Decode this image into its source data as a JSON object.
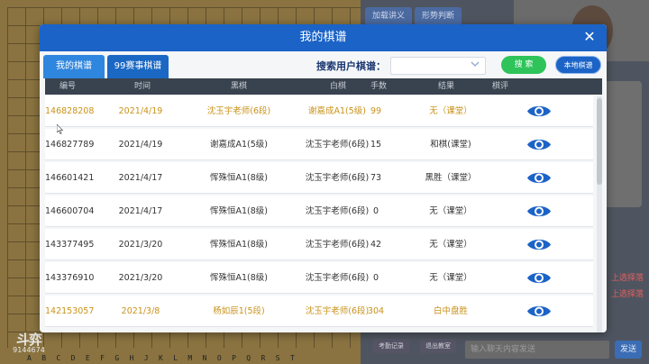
{
  "modal": {
    "title": "我的棋谱",
    "close_icon": "close-icon",
    "tabs": [
      {
        "label": "我的棋谱",
        "active": true
      },
      {
        "label": "99赛事棋谱",
        "active": false
      }
    ],
    "search_label": "搜索用户棋谱：",
    "search_value": "",
    "search_button": "搜 索",
    "local_button": "本地棋谱"
  },
  "table": {
    "headers": [
      "编号",
      "时间",
      "黑棋",
      "白棋",
      "手数",
      "结果",
      "棋评"
    ],
    "rows": [
      {
        "id": "146828208",
        "date": "2021/4/19",
        "black": "沈玉宇老师(6段)",
        "white": "谢嘉成A1(5级)",
        "moves": "99",
        "result": "无（课堂）",
        "highlight": true
      },
      {
        "id": "146827789",
        "date": "2021/4/19",
        "black": "谢嘉成A1(5级)",
        "white": "沈玉宇老师(6段)",
        "moves": "15",
        "result": "和棋(课堂)",
        "highlight": false
      },
      {
        "id": "146601421",
        "date": "2021/4/17",
        "black": "恽殊恒A1(8级)",
        "white": "沈玉宇老师(6段)",
        "moves": "73",
        "result": "黑胜（课堂）",
        "highlight": false
      },
      {
        "id": "146600704",
        "date": "2021/4/17",
        "black": "恽殊恒A1(8级)",
        "white": "沈玉宇老师(6段)",
        "moves": "0",
        "result": "无（课堂）",
        "highlight": false
      },
      {
        "id": "143377495",
        "date": "2021/3/20",
        "black": "恽殊恒A1(8级)",
        "white": "沈玉宇老师(6段)",
        "moves": "42",
        "result": "无（课堂）",
        "highlight": false
      },
      {
        "id": "143376910",
        "date": "2021/3/20",
        "black": "恽殊恒A1(8级)",
        "white": "沈玉宇老师(6段)",
        "moves": "0",
        "result": "无（课堂）",
        "highlight": false
      },
      {
        "id": "142153057",
        "date": "2021/3/8",
        "black": "杨如辰1(5段)",
        "white": "沈玉宇老师(6段)",
        "moves": "304",
        "result": "白中盘胜",
        "highlight": true
      }
    ],
    "view_icon": "eye-icon"
  },
  "background": {
    "buttons": [
      "加载讲义",
      "形势判断"
    ],
    "coords": [
      "A",
      "B",
      "C",
      "D",
      "E",
      "F",
      "G",
      "H",
      "J",
      "K",
      "L",
      "M",
      "N",
      "O",
      "P",
      "Q",
      "R",
      "S",
      "T"
    ],
    "chat_placeholder": "输入聊天内容发送",
    "send_label": "发送",
    "footer_buttons": [
      "考勤记录",
      "退出教室"
    ],
    "logo_top": "斗弈",
    "logo_bottom": "9144674",
    "side_hint": [
      "上选择落",
      "上选择落"
    ]
  },
  "colors": {
    "header": "#1b63c7",
    "highlight_text": "#c9921a",
    "search_button": "#2ec45a",
    "eye_icon": "#1b63c7"
  }
}
